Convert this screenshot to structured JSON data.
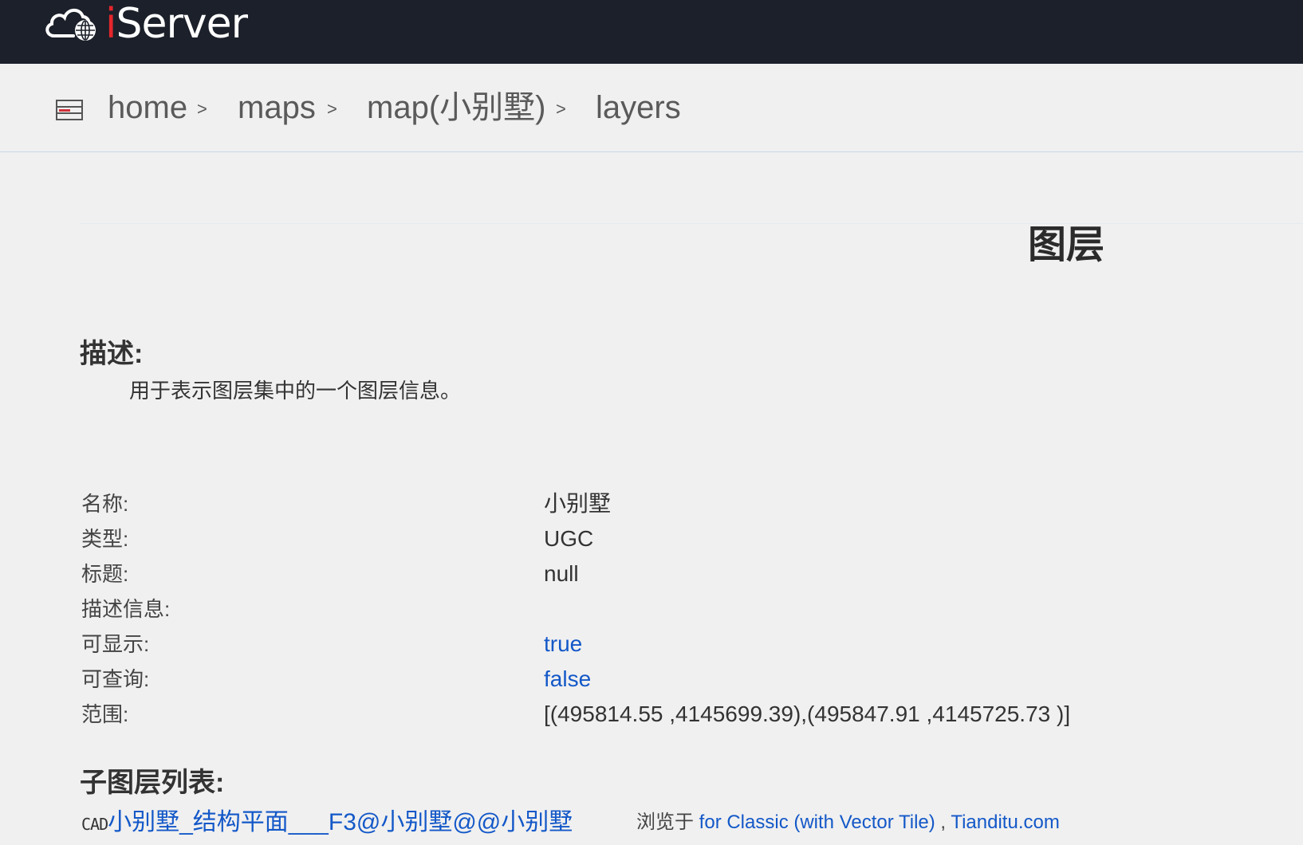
{
  "header": {
    "logo_text_i": "i",
    "logo_text_rest": "Server",
    "logo_icon": "cloud-globe-icon"
  },
  "breadcrumb": {
    "icon": "server-list-icon",
    "items": [
      {
        "label": "home",
        "sep": ">"
      },
      {
        "label": "maps",
        "sep": ">"
      },
      {
        "label": "map(小别墅)",
        "sep": ">"
      },
      {
        "label": "layers",
        "sep": ""
      }
    ]
  },
  "page": {
    "title": "图层",
    "description_heading": "描述:",
    "description_text": "用于表示图层集中的一个图层信息。",
    "properties": [
      {
        "label": "名称:",
        "value": "小别墅",
        "is_link": false
      },
      {
        "label": "类型:",
        "value": "UGC",
        "is_link": false
      },
      {
        "label": "标题:",
        "value": "null",
        "is_link": false
      },
      {
        "label": "描述信息:",
        "value": "",
        "is_link": false
      },
      {
        "label": "可显示:",
        "value": "true",
        "is_link": true
      },
      {
        "label": "可查询:",
        "value": "false",
        "is_link": true
      },
      {
        "label": "范围:",
        "value": "[(495814.55 ,4145699.39),(495847.91 ,4145725.73 )]",
        "is_link": false
      }
    ],
    "sublayers_heading": "子图层列表:",
    "sublayers": [
      {
        "type_tag": "CAD",
        "name": "小别墅_结构平面___F3@小别墅@@小别墅",
        "view_label": "浏览于",
        "view_links": [
          "for Classic (with Vector Tile)",
          "Tianditu.com"
        ],
        "view_separator": ","
      }
    ]
  },
  "colors": {
    "header_bg": "#1b202a",
    "page_bg": "#f0f0f0",
    "link": "#1358c8",
    "logo_accent": "#e4262c"
  }
}
